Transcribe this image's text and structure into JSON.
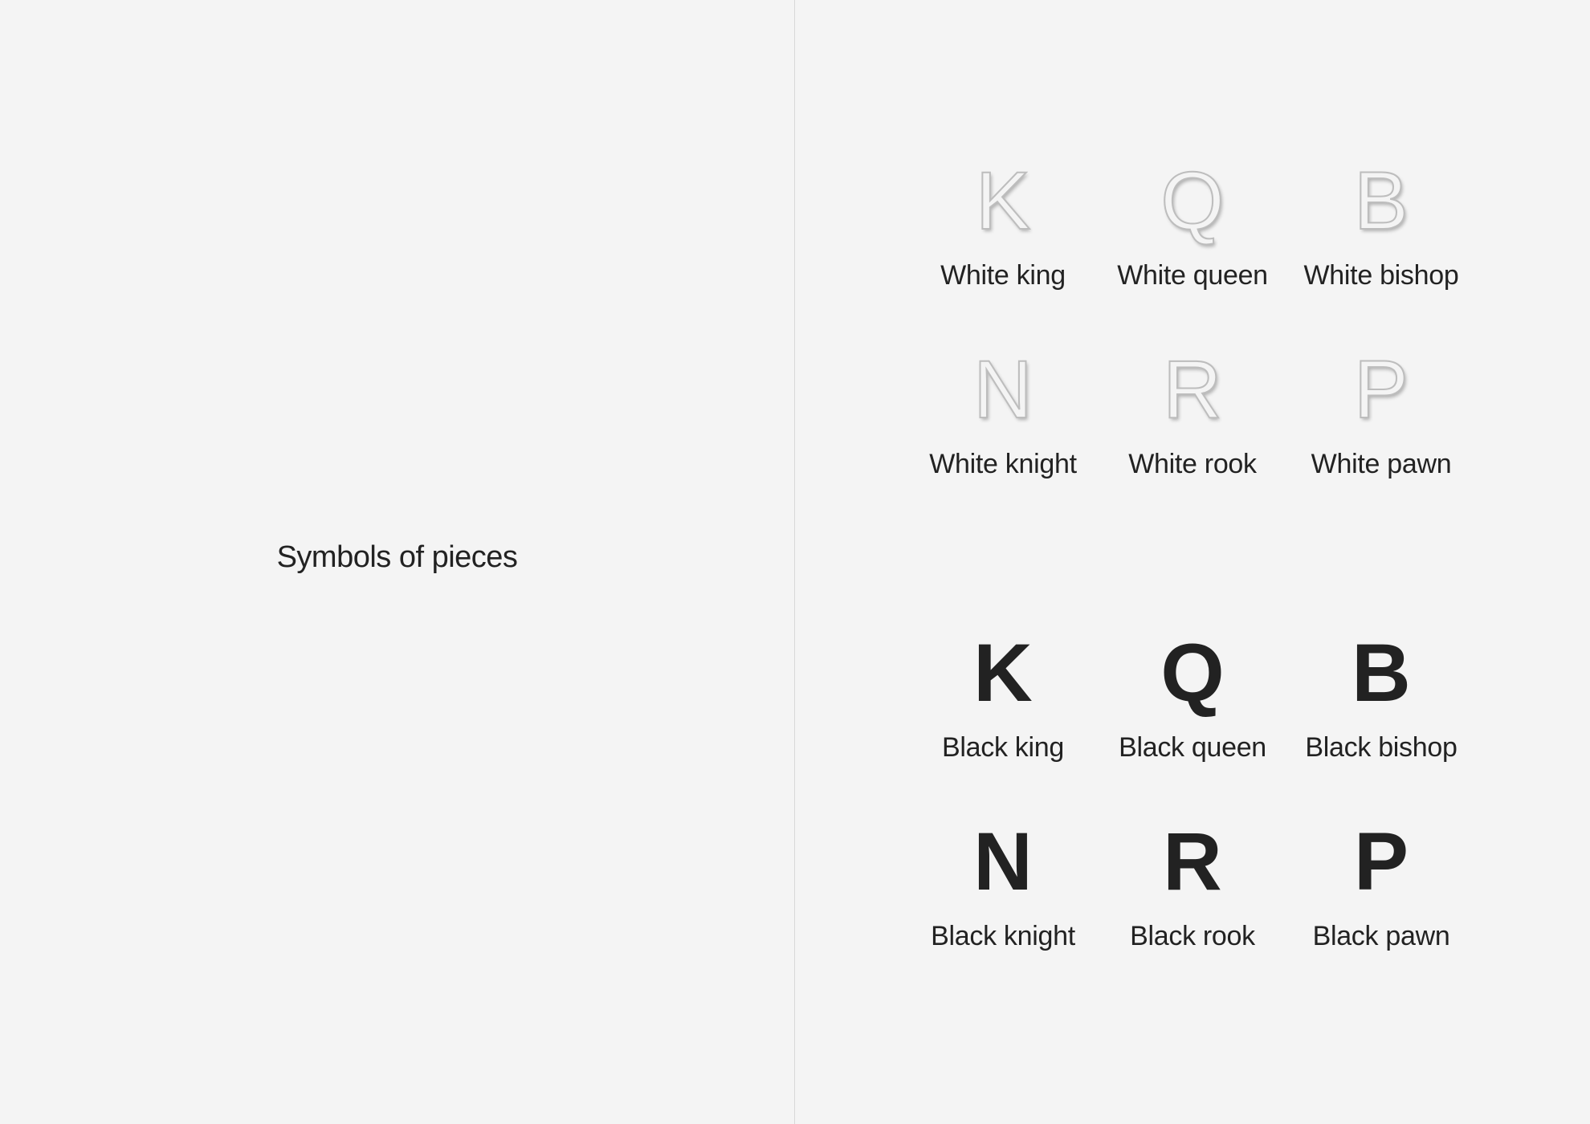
{
  "left_page": {
    "title": "Symbols of pieces"
  },
  "white_pieces": {
    "row1": [
      {
        "symbol": "K",
        "label": "White king"
      },
      {
        "symbol": "Q",
        "label": "White queen"
      },
      {
        "symbol": "B",
        "label": "White bishop"
      }
    ],
    "row2": [
      {
        "symbol": "N",
        "label": "White knight"
      },
      {
        "symbol": "R",
        "label": "White rook"
      },
      {
        "symbol": "P",
        "label": "White pawn"
      }
    ]
  },
  "black_pieces": {
    "row1": [
      {
        "symbol": "K",
        "label": "Black king"
      },
      {
        "symbol": "Q",
        "label": "Black queen"
      },
      {
        "symbol": "B",
        "label": "Black bishop"
      }
    ],
    "row2": [
      {
        "symbol": "N",
        "label": "Black knight"
      },
      {
        "symbol": "R",
        "label": "Black rook"
      },
      {
        "symbol": "P",
        "label": "Black pawn"
      }
    ]
  },
  "colors": {
    "background": "#f4f4f4",
    "text": "#222222",
    "divider": "#d8d8d8",
    "white_piece_outline": "#bdbdbd"
  }
}
